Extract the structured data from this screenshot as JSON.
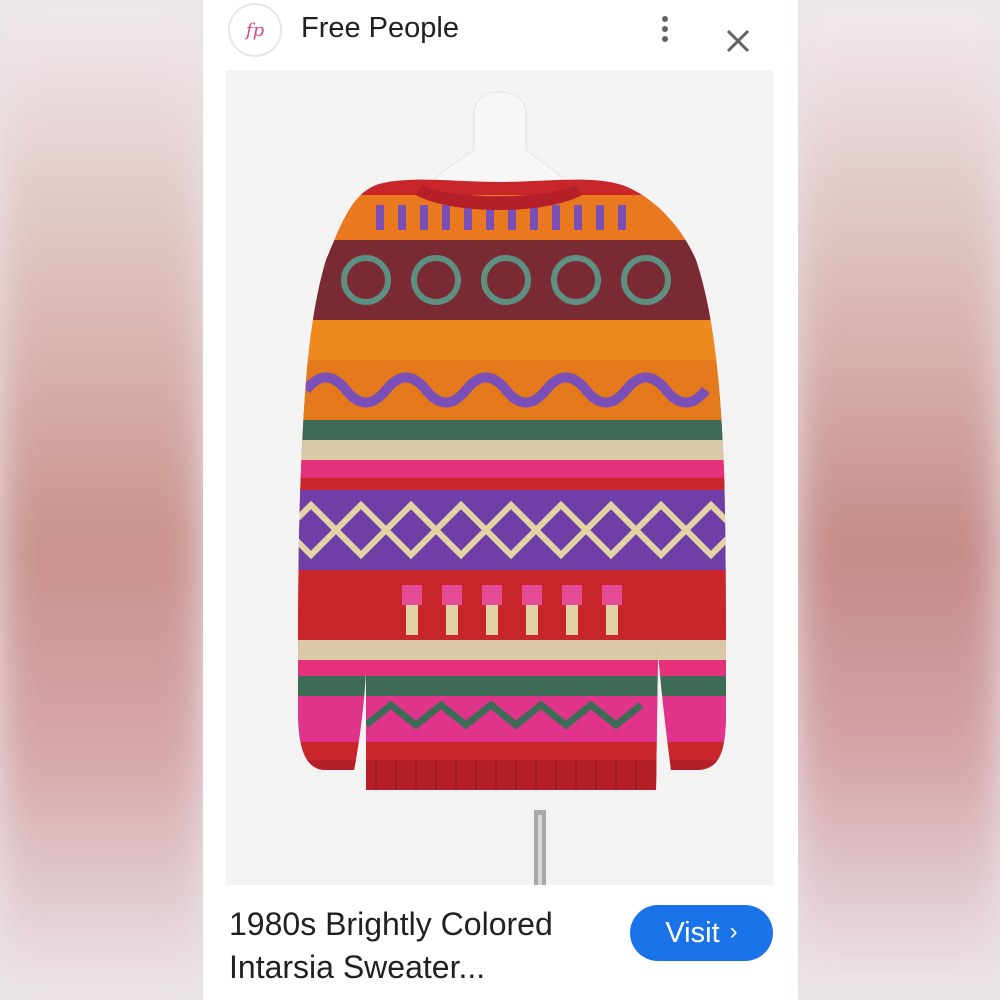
{
  "header": {
    "logo_text": "fp",
    "brand_name": "Free People"
  },
  "product": {
    "title": "1980s Brightly Colored Intarsia Sweater...",
    "image_icon": "sweater-photo"
  },
  "actions": {
    "visit_label": "Visit",
    "visit_chevron": "›",
    "more_icon": "more-vert-icon",
    "close_icon": "close-icon"
  },
  "colors": {
    "accent": "#1a73e8",
    "brand_pink": "#d9478e"
  }
}
